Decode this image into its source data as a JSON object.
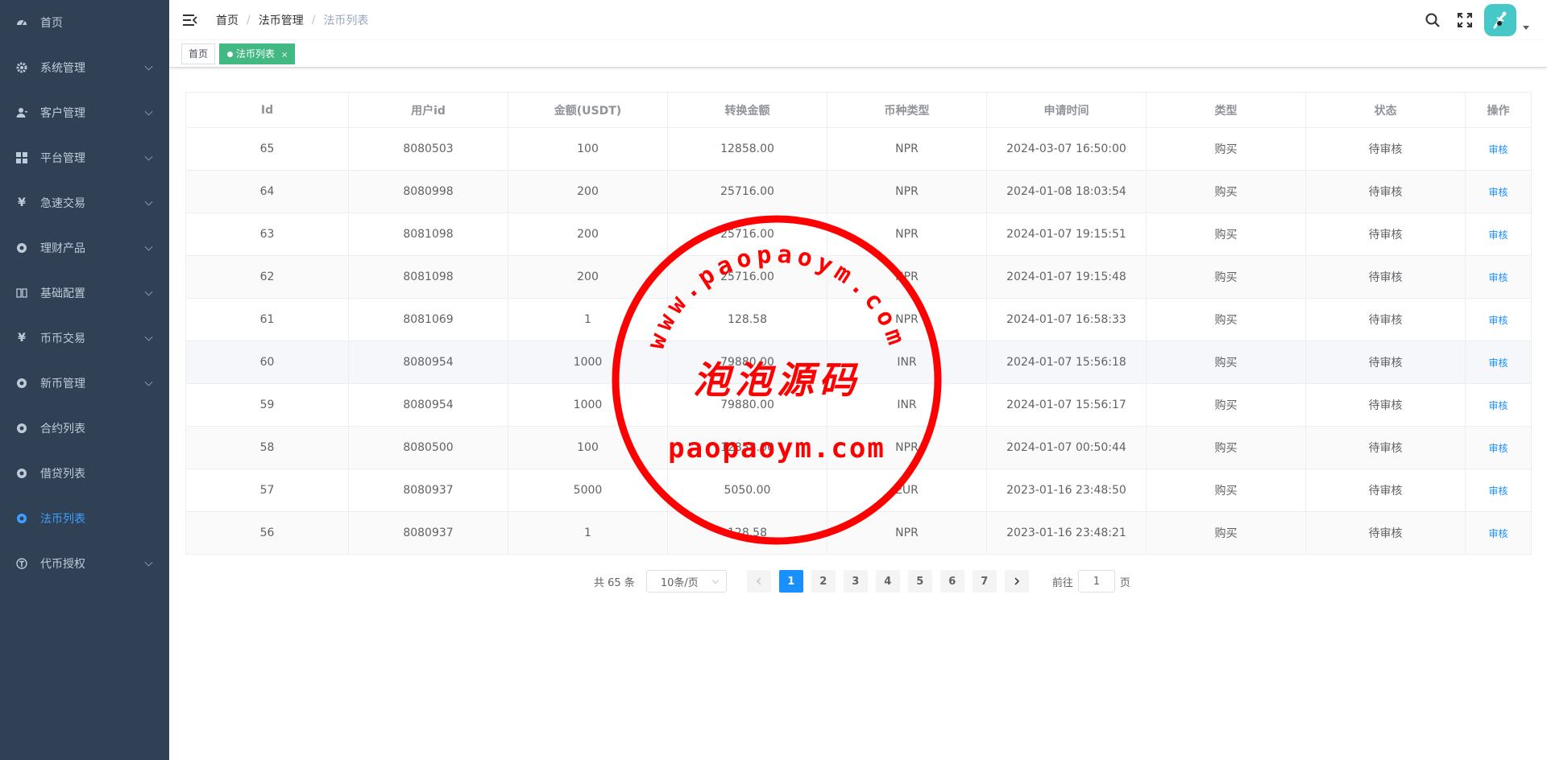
{
  "sidebar": {
    "items": [
      {
        "label": "首页",
        "icon": "dashboard-icon",
        "has_children": false,
        "active": false
      },
      {
        "label": "系统管理",
        "icon": "gear-icon",
        "has_children": true,
        "active": false
      },
      {
        "label": "客户管理",
        "icon": "user-icon",
        "has_children": true,
        "active": false
      },
      {
        "label": "平台管理",
        "icon": "grid-icon",
        "has_children": true,
        "active": false
      },
      {
        "label": "急速交易",
        "icon": "yen-icon",
        "has_children": true,
        "active": false
      },
      {
        "label": "理财产品",
        "icon": "circle-icon",
        "has_children": true,
        "active": false
      },
      {
        "label": "基础配置",
        "icon": "book-icon",
        "has_children": true,
        "active": false
      },
      {
        "label": "币币交易",
        "icon": "yen-icon",
        "has_children": true,
        "active": false
      },
      {
        "label": "新币管理",
        "icon": "circle-icon",
        "has_children": true,
        "active": false
      },
      {
        "label": "合约列表",
        "icon": "circle-icon",
        "has_children": false,
        "active": false
      },
      {
        "label": "借贷列表",
        "icon": "circle-icon",
        "has_children": false,
        "active": false
      },
      {
        "label": "法币列表",
        "icon": "circle-icon",
        "has_children": false,
        "active": true
      },
      {
        "label": "代币授权",
        "icon": "token-icon",
        "has_children": true,
        "active": false
      }
    ]
  },
  "breadcrumb": [
    "首页",
    "法币管理",
    "法币列表"
  ],
  "tags": [
    {
      "label": "首页",
      "active": false
    },
    {
      "label": "法币列表",
      "active": true,
      "close": "×"
    }
  ],
  "table": {
    "headers": [
      "Id",
      "用户id",
      "金额(USDT)",
      "转换金额",
      "币种类型",
      "申请时间",
      "类型",
      "状态",
      "操作"
    ],
    "rows": [
      [
        "65",
        "8080503",
        "100",
        "12858.00",
        "NPR",
        "2024-03-07 16:50:00",
        "购买",
        "待审核",
        "审核"
      ],
      [
        "64",
        "8080998",
        "200",
        "25716.00",
        "NPR",
        "2024-01-08 18:03:54",
        "购买",
        "待审核",
        "审核"
      ],
      [
        "63",
        "8081098",
        "200",
        "25716.00",
        "NPR",
        "2024-01-07 19:15:51",
        "购买",
        "待审核",
        "审核"
      ],
      [
        "62",
        "8081098",
        "200",
        "25716.00",
        "NPR",
        "2024-01-07 19:15:48",
        "购买",
        "待审核",
        "审核"
      ],
      [
        "61",
        "8081069",
        "1",
        "128.58",
        "NPR",
        "2024-01-07 16:58:33",
        "购买",
        "待审核",
        "审核"
      ],
      [
        "60",
        "8080954",
        "1000",
        "79880.00",
        "INR",
        "2024-01-07 15:56:18",
        "购买",
        "待审核",
        "审核"
      ],
      [
        "59",
        "8080954",
        "1000",
        "79880.00",
        "INR",
        "2024-01-07 15:56:17",
        "购买",
        "待审核",
        "审核"
      ],
      [
        "58",
        "8080500",
        "100",
        "12858.00",
        "NPR",
        "2024-01-07 00:50:44",
        "购买",
        "待审核",
        "审核"
      ],
      [
        "57",
        "8080937",
        "5000",
        "5050.00",
        "EUR",
        "2023-01-16 23:48:50",
        "购买",
        "待审核",
        "审核"
      ],
      [
        "56",
        "8080937",
        "1",
        "128.58",
        "NPR",
        "2023-01-16 23:48:21",
        "购买",
        "待审核",
        "审核"
      ]
    ]
  },
  "pagination": {
    "total_label": "共 65 条",
    "page_size": "10条/页",
    "pages": [
      "1",
      "2",
      "3",
      "4",
      "5",
      "6",
      "7"
    ],
    "current": "1",
    "goto_label": "前往",
    "goto_value": "1",
    "page_unit": "页"
  },
  "watermark": {
    "arc_text": "www.paopaoym.com",
    "center_text": "泡泡源码",
    "bottom_text": "paopaoym.com",
    "color": "#ff0000"
  },
  "colors": {
    "sidebar_bg": "#304156",
    "sidebar_text": "#bfcbd9",
    "accent": "#409eff",
    "tag_active": "#42b983",
    "link": "#1890ff"
  }
}
